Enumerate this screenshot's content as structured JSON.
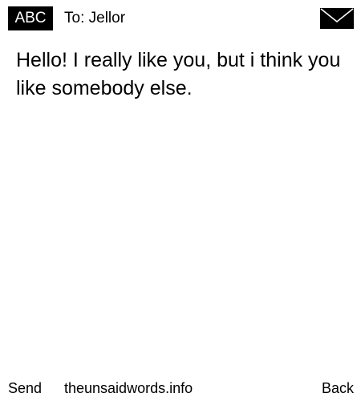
{
  "header": {
    "input_mode": "ABC",
    "recipient": "To: Jellor",
    "status_icon": "envelope-icon"
  },
  "message": {
    "body": "Hello! I really like you, but i think you like somebody else."
  },
  "softkeys": {
    "left_label": "Send",
    "center_label": "theunsaidwords.info",
    "right_label": "Back"
  },
  "colors": {
    "background": "#ffffff",
    "foreground": "#000000"
  }
}
